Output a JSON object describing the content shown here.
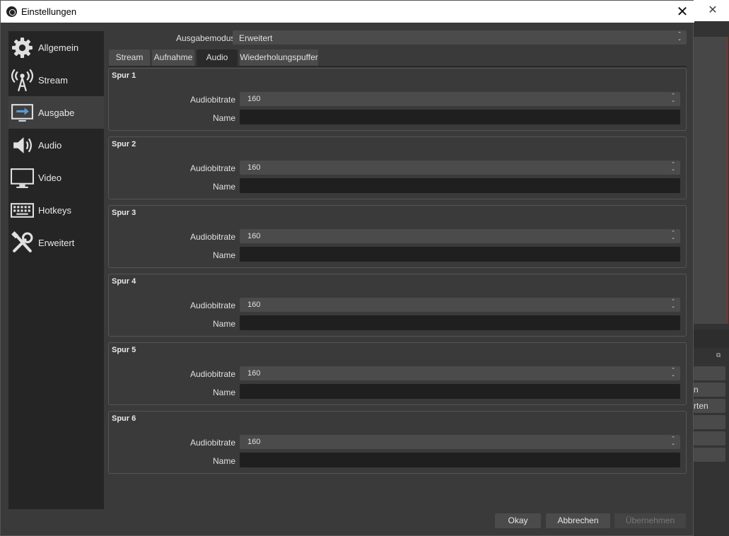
{
  "window": {
    "title": "Einstellungen",
    "close_glyph": "✕"
  },
  "background": {
    "close_glyph": "✕",
    "buttons": [
      "",
      "n",
      "rten",
      "",
      "",
      ""
    ]
  },
  "sidebar": {
    "items": [
      {
        "label": "Allgemein",
        "icon": "gear-icon",
        "active": false
      },
      {
        "label": "Stream",
        "icon": "antenna-icon",
        "active": false
      },
      {
        "label": "Ausgabe",
        "icon": "output-icon",
        "active": true
      },
      {
        "label": "Audio",
        "icon": "speaker-icon",
        "active": false
      },
      {
        "label": "Video",
        "icon": "monitor-icon",
        "active": false
      },
      {
        "label": "Hotkeys",
        "icon": "keyboard-icon",
        "active": false
      },
      {
        "label": "Erweitert",
        "icon": "tools-icon",
        "active": false
      }
    ]
  },
  "output_mode": {
    "label": "Ausgabemodus",
    "value": "Erweitert"
  },
  "tabs": [
    {
      "label": "Stream",
      "active": false
    },
    {
      "label": "Aufnahme",
      "active": false
    },
    {
      "label": "Audio",
      "active": true
    },
    {
      "label": "Wiederholungspuffer",
      "active": false
    }
  ],
  "tracks": [
    {
      "title": "Spur 1",
      "bitrate_label": "Audiobitrate",
      "bitrate": "160",
      "name_label": "Name",
      "name": ""
    },
    {
      "title": "Spur 2",
      "bitrate_label": "Audiobitrate",
      "bitrate": "160",
      "name_label": "Name",
      "name": ""
    },
    {
      "title": "Spur 3",
      "bitrate_label": "Audiobitrate",
      "bitrate": "160",
      "name_label": "Name",
      "name": ""
    },
    {
      "title": "Spur 4",
      "bitrate_label": "Audiobitrate",
      "bitrate": "160",
      "name_label": "Name",
      "name": ""
    },
    {
      "title": "Spur 5",
      "bitrate_label": "Audiobitrate",
      "bitrate": "160",
      "name_label": "Name",
      "name": ""
    },
    {
      "title": "Spur 6",
      "bitrate_label": "Audiobitrate",
      "bitrate": "160",
      "name_label": "Name",
      "name": ""
    }
  ],
  "buttons": {
    "okay": "Okay",
    "cancel": "Abbrechen",
    "apply": "Übernehmen"
  },
  "colors": {
    "window_bg": "#3a3a3a",
    "sidebar_bg": "#252525",
    "active_item_bg": "#3f3f3f",
    "input_bg": "#1f1f1f",
    "combo_bg": "#4b4b4b"
  }
}
